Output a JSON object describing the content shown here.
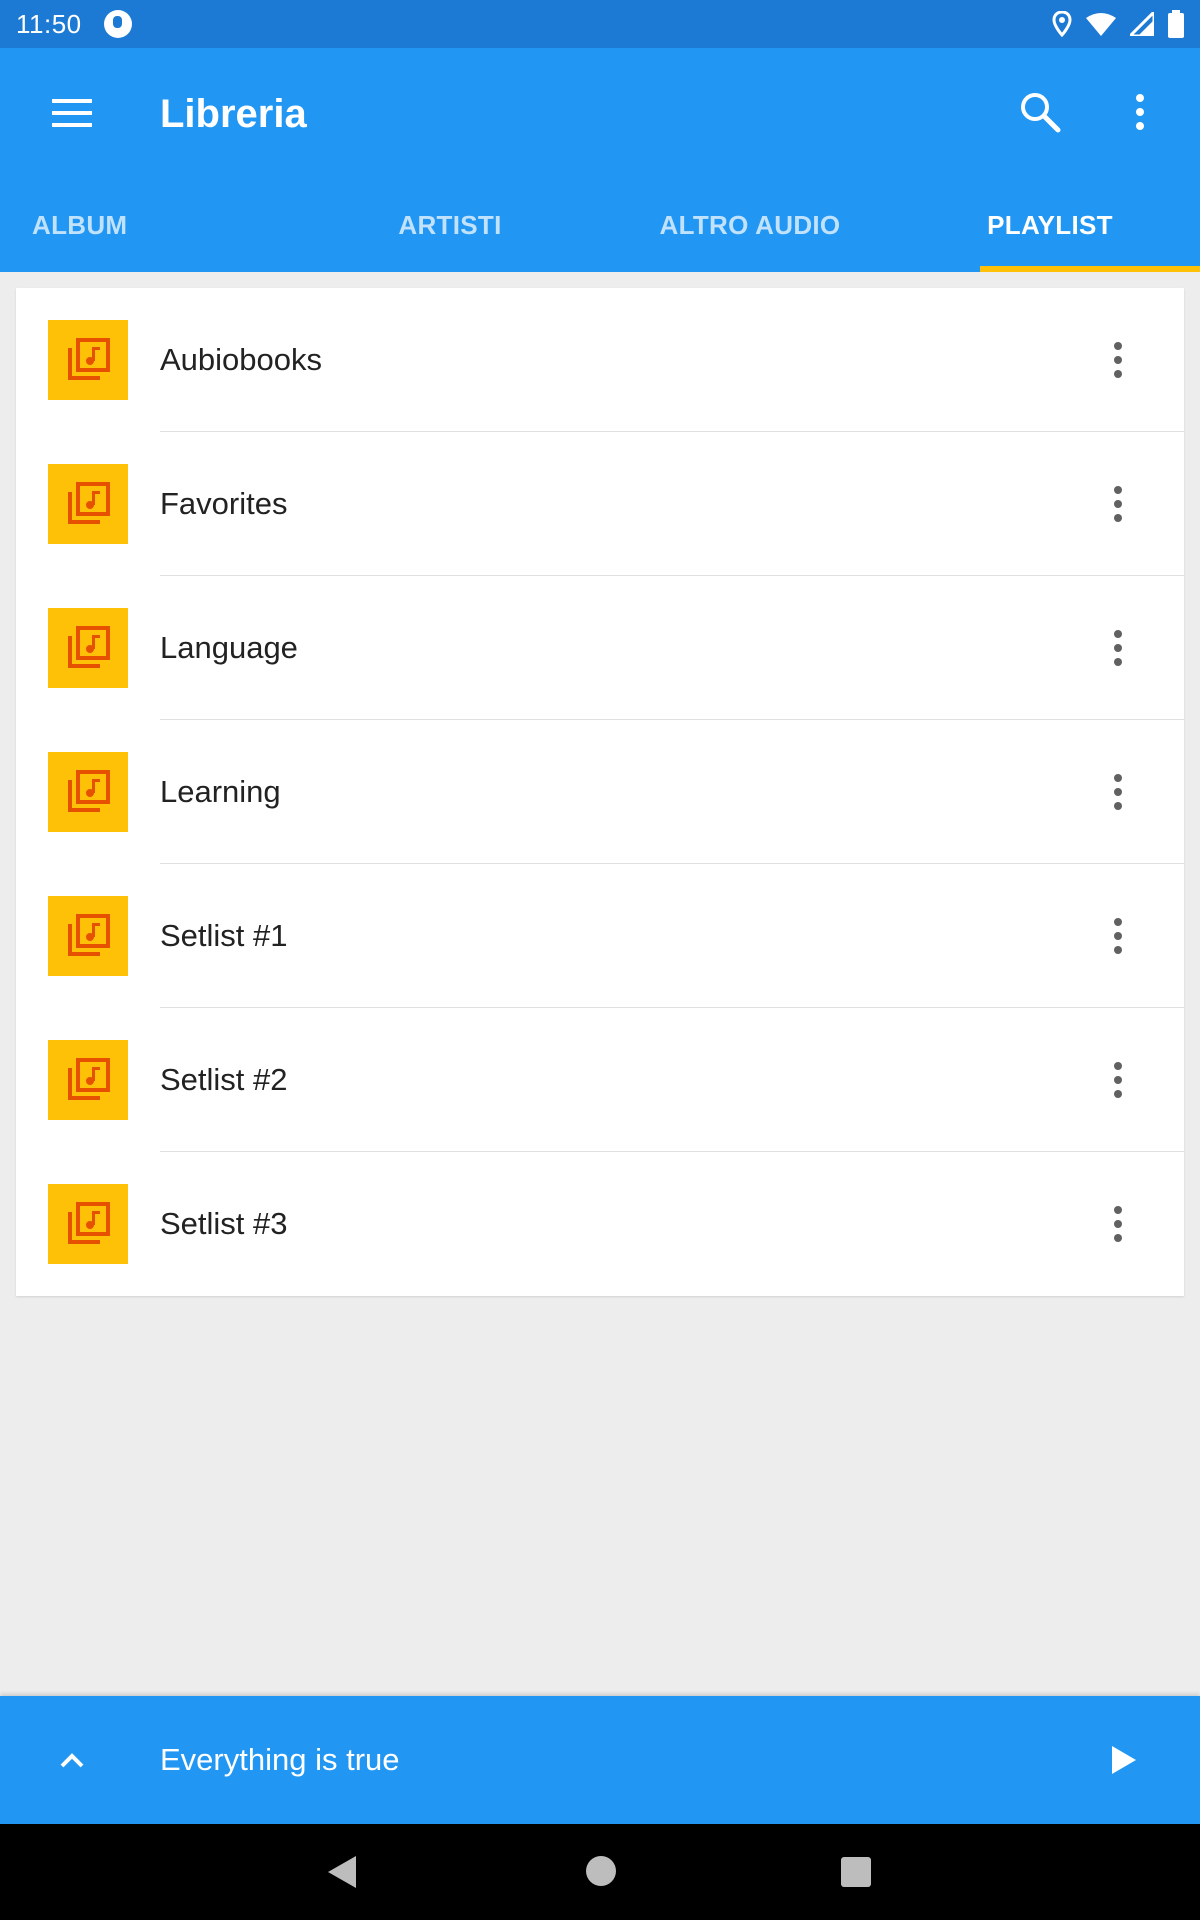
{
  "status_bar": {
    "time": "11:50"
  },
  "app_bar": {
    "title": "Libreria",
    "tabs": [
      {
        "label": "ALBUM",
        "active": false
      },
      {
        "label": "ARTISTI",
        "active": false
      },
      {
        "label": "ALTRO AUDIO",
        "active": false
      },
      {
        "label": "PLAYLIST",
        "active": true
      }
    ]
  },
  "playlists": [
    {
      "name": "Aubiobooks"
    },
    {
      "name": "Favorites"
    },
    {
      "name": "Language"
    },
    {
      "name": "Learning"
    },
    {
      "name": "Setlist #1"
    },
    {
      "name": "Setlist #2"
    },
    {
      "name": "Setlist #3"
    }
  ],
  "now_playing": {
    "title": "Everything is true"
  },
  "colors": {
    "status_bar": "#1d7ad4",
    "primary": "#2196f3",
    "accent": "#ffc107",
    "thumb_icon": "#e65100"
  },
  "icons": {
    "menu": "menu-icon",
    "search": "search-icon",
    "more": "more-vert-icon",
    "playlist": "playlist-music-icon",
    "expand": "chevron-up-icon",
    "play": "play-icon"
  }
}
